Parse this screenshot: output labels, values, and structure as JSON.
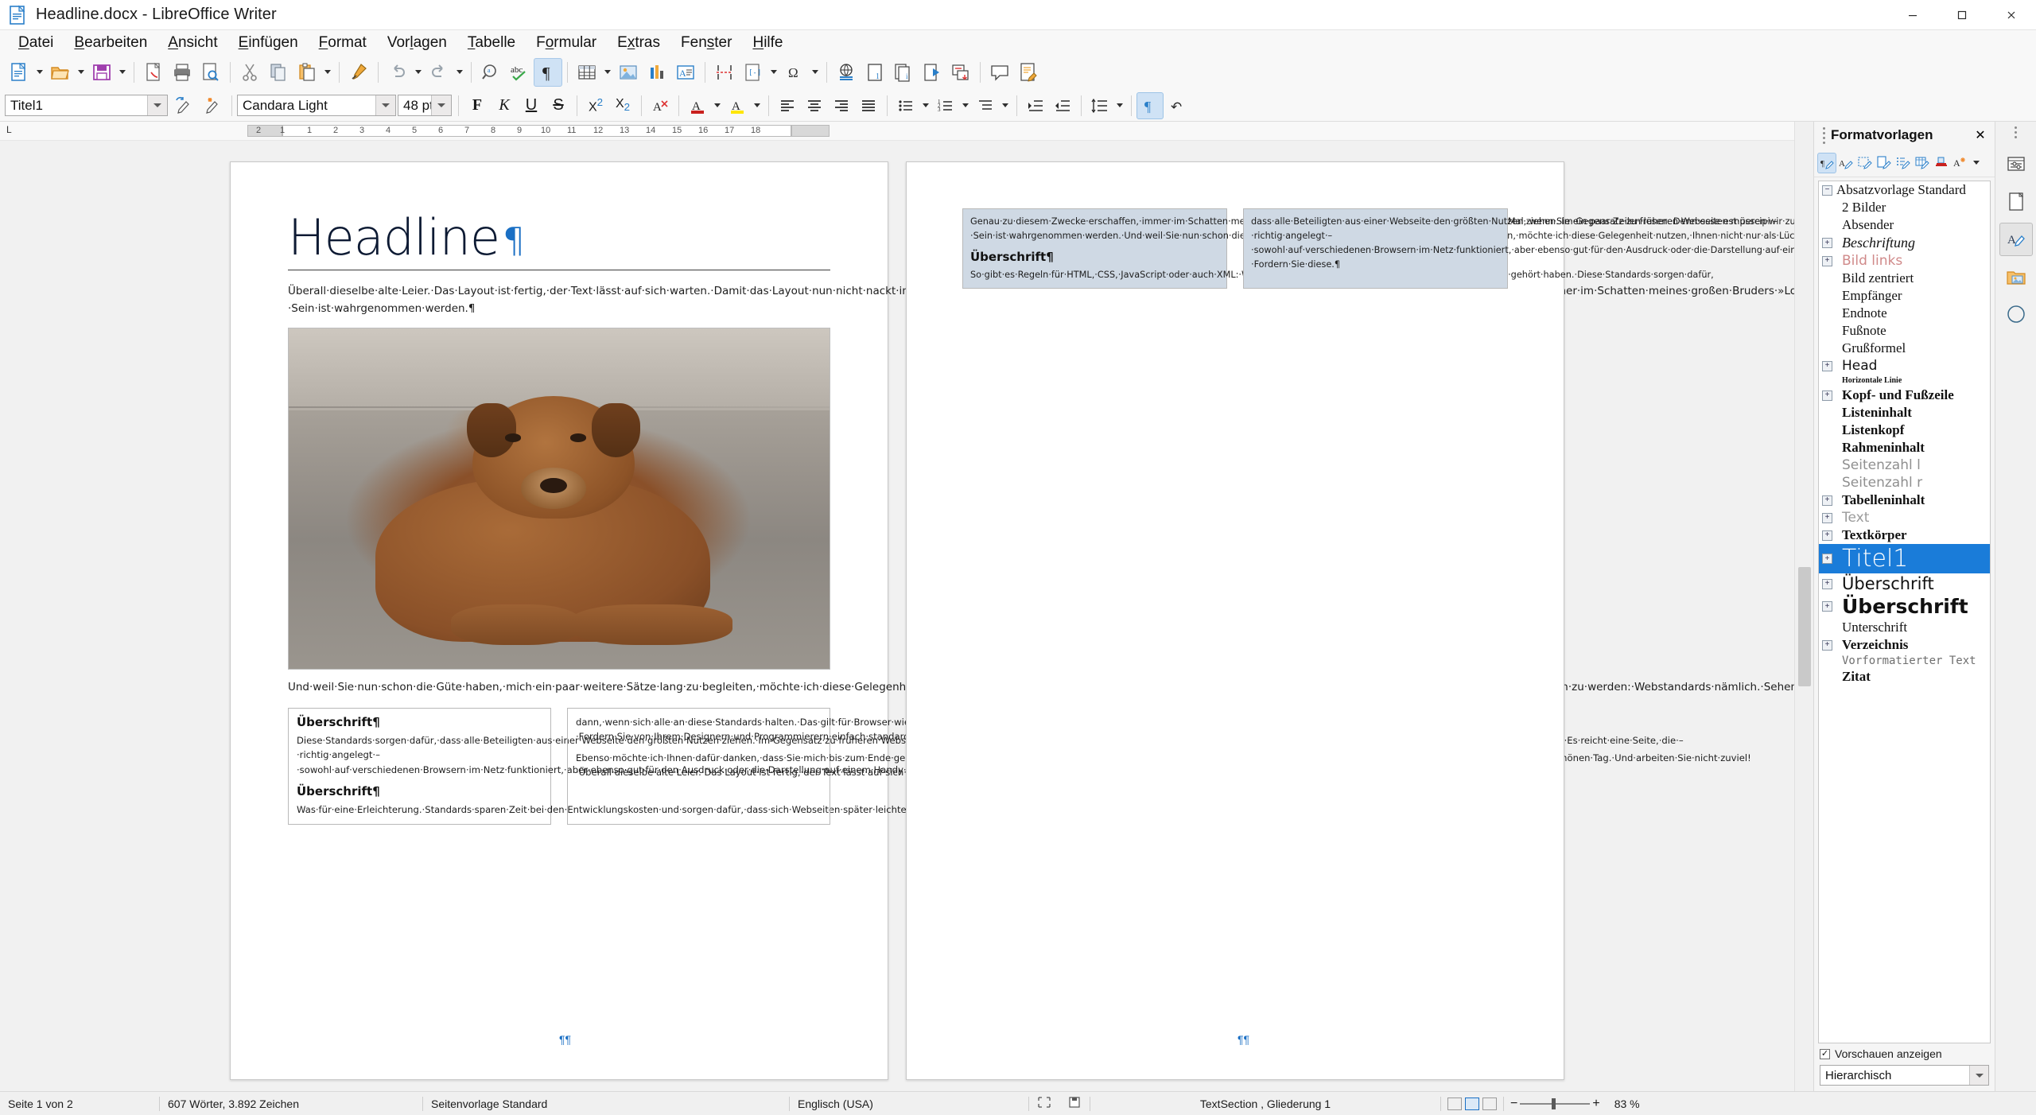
{
  "window": {
    "title": "Headline.docx - LibreOffice Writer",
    "minimize": "—",
    "maximize": "□",
    "close": "✕"
  },
  "menu": [
    {
      "label": "Datei",
      "accel": "D"
    },
    {
      "label": "Bearbeiten",
      "accel": "B"
    },
    {
      "label": "Ansicht",
      "accel": "A"
    },
    {
      "label": "Einfügen",
      "accel": "E"
    },
    {
      "label": "Format",
      "accel": "F"
    },
    {
      "label": "Vorlagen",
      "accel": "l"
    },
    {
      "label": "Tabelle",
      "accel": "T"
    },
    {
      "label": "Formular",
      "accel": "o"
    },
    {
      "label": "Extras",
      "accel": "x"
    },
    {
      "label": "Fenster",
      "accel": "s"
    },
    {
      "label": "Hilfe",
      "accel": "H"
    }
  ],
  "toolbar_main": [
    {
      "name": "new-document",
      "tooltip": "Neu"
    },
    {
      "name": "open-document",
      "tooltip": "Öffnen"
    },
    {
      "name": "save-document",
      "tooltip": "Speichern"
    },
    {
      "name": "export-pdf",
      "tooltip": "Direkt als PDF exportieren"
    },
    {
      "name": "print",
      "tooltip": "Drucken"
    },
    {
      "name": "print-preview",
      "tooltip": "Druckvorschau"
    },
    {
      "name": "cut",
      "tooltip": "Ausschneiden"
    },
    {
      "name": "copy",
      "tooltip": "Kopieren"
    },
    {
      "name": "paste",
      "tooltip": "Einfügen"
    },
    {
      "name": "clone-formatting",
      "tooltip": "Formatierung klonen"
    },
    {
      "name": "undo",
      "tooltip": "Rückgängig"
    },
    {
      "name": "redo",
      "tooltip": "Wiederherstellen"
    },
    {
      "name": "find-replace",
      "tooltip": "Suchen und Ersetzen"
    },
    {
      "name": "spelling",
      "tooltip": "Rechtschreibung"
    },
    {
      "name": "formatting-marks",
      "tooltip": "Formatierungszeichen",
      "active": true
    },
    {
      "name": "insert-table",
      "tooltip": "Tabelle einfügen"
    },
    {
      "name": "insert-image",
      "tooltip": "Bild einfügen"
    },
    {
      "name": "insert-chart",
      "tooltip": "Diagramm einfügen"
    },
    {
      "name": "insert-text-box",
      "tooltip": "Textfeld einfügen"
    },
    {
      "name": "page-break",
      "tooltip": "Seitenumbruch einfügen"
    },
    {
      "name": "insert-field",
      "tooltip": "Feldbefehl einfügen"
    },
    {
      "name": "insert-special-character",
      "tooltip": "Sonderzeichen einfügen"
    },
    {
      "name": "insert-hyperlink",
      "tooltip": "Hyperlink einfügen"
    },
    {
      "name": "insert-footnote",
      "tooltip": "Fußnote einfügen"
    },
    {
      "name": "insert-endnote",
      "tooltip": "Endnote einfügen"
    },
    {
      "name": "insert-bookmark",
      "tooltip": "Lesezeichen einfügen"
    },
    {
      "name": "insert-cross-reference",
      "tooltip": "Querverweis einfügen"
    },
    {
      "name": "insert-comment",
      "tooltip": "Kommentar einfügen"
    },
    {
      "name": "track-changes",
      "tooltip": "Änderungen aufzeichnen"
    }
  ],
  "formatting": {
    "paragraph_style": "Titel1",
    "font_name": "Candara Light",
    "font_size": "48 pt",
    "bold": "F",
    "italic": "K",
    "underline": "U",
    "strikethrough": "S",
    "superscript": "X²",
    "subscript": "X₂",
    "clear_formatting": "A",
    "font_color": "A",
    "highlight_color": "A",
    "align_left": "≡",
    "align_center": "≡",
    "align_right": "≡",
    "align_justify": "≡",
    "formatting_marks_label": "¶"
  },
  "ruler": {
    "ticks": [
      "2",
      "1",
      "1",
      "2",
      "3",
      "4",
      "5",
      "6",
      "7",
      "8",
      "9",
      "10",
      "11",
      "12",
      "13",
      "14",
      "15",
      "16",
      "17",
      "18"
    ],
    "left_marker": "L"
  },
  "document": {
    "page1": {
      "headline": "Headline",
      "pilcrow": "¶",
      "intro": "Überall·dieselbe·alte·Leier.·Das·Layout·ist·fertig,·der·Text·lässt·auf·sich·warten.·Damit·das·Layout·nun·nicht·nackt·im·Raume·steht·und·sich·klein·und·leer·vorkommt,·springe·ich·ein:·der·Blindtext.·Genau·zu·diesem·Zwecke·erschaffen,·immer·im·Schatten·meines·großen·Bruders·»Lorem·Ipsum«,·freue·ich·mich·jedes·Mal,·wenn·Sie·ein·paar·Zeilen·lesen.·Denn·esse·est·percipi·–·Sein·ist·wahrgenommen·werden.¶",
      "image_caption_para": "Und·weil·Sie·nun·schon·die·Güte·haben,·mich·ein·paar·weitere·Sätze·lang·zu·begleiten,·möchte·ich·diese·Gelegenheit·nutzen,·Ihnen·nicht·nur·als·Lückenfüller·zu·dienen,·sondern·auf·etwas·hinzuweisen.·Es·ebenso·verdient·wahrgenommen·zu·werden:·Webstandards·nämlich.·Sehen·Sie,·Webstandards·sind·das·Regelwerk,·auf·dem·Webseiten·aufbauen.·So·gibt·es·Regeln·für·HTML,·CSS,·JavaScript·oder·auch·XML:·Worte,·die·Sie·vielleicht·schon·einmal·von·Ihrem·Entwickler·gehört·haben.¶",
      "col_left": {
        "heading": "Überschrift¶",
        "body1": "Diese·Standards·sorgen·dafür,·dass·alle·Beteiligten·aus·einer·Webseite·den·größten·Nutzen·ziehen.·Im·Gegensatz·zu·früheren·Webseiten·müssen·wir·zum·Beispiel·nicht·mehr·zwei·verschiedene·Webseiten·für·den·Internet·Explorer·und·einen·anderen·Browser·programmieren.·Es·reicht·eine·Seite,·die·–·richtig·angelegt·–·sowohl·auf·verschiedenen·Browsern·im·Netz·funktioniert,·aber·ebenso·gut·für·den·Ausdruck·oder·die·Darstellung·auf·einem·Handy·geeignet·ist.·Wohlgemerkt:·Eine·Seite·für·alle·Formate.¶",
        "heading2": "Überschrift¶",
        "body2": "Was·für·eine·Erleichterung.·Standards·sparen·Zeit·bei·den·Entwicklungskosten·und·sorgen·dafür,·dass·sich·Webseiten·später·leichter·pflegen·lassen.·Natürlich·nur"
      },
      "col_right": {
        "body1": "dann,·wenn·sich·alle·an·diese·Standards·halten.·Das·gilt·für·Browser·wie·Firefox,·Opera,·Safari·und·den·Internet·Explorer·ebenso·wie·für·die·Darstellung·in·Handys.·Und·was·können·Sie·für·Standards·tun?·Fordern·Sie·von·Ihrem·Designern·und·Programmierern·einfach·standardkonforme·Webseiten.·Ihr·Budget·wird·es·Ihnen·auf·Dauer·danken.¶",
        "body2": "Ebenso·möchte·ich·Ihnen·dafür·danken,·dass·Sie·mich·bis·zum·Ende·gelesen·haben.·Meine·Mission·ist·erfüllt.·Ich·werde·hier·noch·die·Stellung·halten,·bis·der·geplante·Text·eintrifft.·Ich·wünsche·Ihnen·noch·einen·schönen·Tag.·Und·arbeiten·Sie·nicht·zuviel!·Überall·dieselbe·alte·Leier.·Das·Layout·ist·fertig,·der·Text·lässt·auf·sich·warten.·Damit·das·Layout·nun·nicht·nackt·im·Raume·steht·und·sich·klein·und·leer·vorkommt,·springe·ich·ein:·der·Blindtext.¶"
      },
      "end_mark": "¶¶"
    },
    "page2": {
      "col_left": {
        "body1": "Genau·zu·diesem·Zwecke·erschaffen,·immer·im·Schatten·meines·großen·Bruders·»Lorem·Ipsum«,·freue·ich·mich·jedes·Mal,·wenn·Sie·ein·paar·Zeilen·lesen.·Denn·esse·est·percipi·–·Sein·ist·wahrgenommen·werden.·Und·weil·Sie·nun·schon·die·Güte·haben,·mich·ein·paar·weitere·Sätze·lang·zu·begleiten,·möchte·ich·diese·Gelegenheit·nutzen,·Ihnen·nicht·nur·als·Lückenfüller·zu·dienen,·sondern·auf·etwas·hinzuweisen,·das·es·ebenso·verdient·wahrgenommen·zu·werden:·Webstandards·nämlich.·Sehen·Sie,·Webstandards·sind·das·Regelwerk,·auf·dem·Webseiten·aufbauen.¶",
        "heading": "Überschrift¶",
        "body2": "So·gibt·es·Regeln·für·HTML,·CSS,·JavaScript·oder·auch·XML:·Worte,·die·Sie·vielleicht·schon·einmal·von·Ihrem·Entwickler·gehört·haben.·Diese·Standards·sorgen·dafür,"
      },
      "col_right": {
        "body1": "dass·alle·Beteiligten·aus·einer·Webseite·den·größten·Nutzen·ziehen.·Im·Gegensatz·zu·früheren·Webseiten·müssen·wir·zum·Beispiel·nicht·mehr·zwei·verschiedene·Webseiten·für·den·Internet·Explorer·und·einen·anderen·Browser·programmieren.·Es·reicht·eine·Seite,·die·–·richtig·angelegt·–·sowohl·auf·verschiedenen·Browsern·im·Netz·funktioniert,·aber·ebenso·gut·für·den·Ausdruck·oder·die·Darstellung·auf·einem·Handy·geeignet·ist.·Wohlgemerkt:·Standards·sparen·Zeit·bei·den·Entwicklungskosten·und·sorgen·dafür,·dass·sich·Webseiten·später·leichter·pflegen·lassen.·Natürlich·nur·dann,·wenn·sich·alle·an·diese·Standards·halten.·Das·gilt·für·Browser·wie·Firefox,·Opera,·Safari·und·den·Internet·Explorer·ebenso·wie·für·die·Darstellung·in·Handys.·Und·was·können·Sie·für·Standards·tun?·Fordern·Sie·diese.¶"
      },
      "end_mark": "¶¶"
    }
  },
  "sidebar": {
    "title": "Formatvorlagen",
    "close": "✕",
    "toolbar": [
      {
        "name": "paragraph-styles",
        "selected": true
      },
      {
        "name": "character-styles",
        "selected": false
      },
      {
        "name": "frame-styles",
        "selected": false
      },
      {
        "name": "page-styles",
        "selected": false
      },
      {
        "name": "list-styles",
        "selected": false
      },
      {
        "name": "table-styles",
        "selected": false
      },
      {
        "name": "fill-format-mode",
        "selected": false
      },
      {
        "name": "new-style-from-selection",
        "selected": false
      }
    ],
    "styles": [
      {
        "label": "Absatzvorlage Standard",
        "expander": "minus",
        "indent": 0,
        "preview": "s-serif"
      },
      {
        "label": "2 Bilder",
        "expander": "none",
        "indent": 1,
        "preview": "s-serif"
      },
      {
        "label": "Absender",
        "expander": "none",
        "indent": 1,
        "preview": "s-serif"
      },
      {
        "label": "Beschriftung",
        "expander": "plus",
        "indent": 1,
        "preview": "s-serifI"
      },
      {
        "label": "Bild links",
        "expander": "plus",
        "indent": 1,
        "preview": "s-sansPnk"
      },
      {
        "label": "Bild zentriert",
        "expander": "none",
        "indent": 1,
        "preview": "s-serif"
      },
      {
        "label": "Empfänger",
        "expander": "none",
        "indent": 1,
        "preview": "s-serif"
      },
      {
        "label": "Endnote",
        "expander": "none",
        "indent": 1,
        "preview": "s-serif"
      },
      {
        "label": "Fußnote",
        "expander": "none",
        "indent": 1,
        "preview": "s-serif"
      },
      {
        "label": "Grußformel",
        "expander": "none",
        "indent": 1,
        "preview": "s-serif"
      },
      {
        "label": "Head",
        "expander": "plus",
        "indent": 1,
        "preview": "s-sans"
      },
      {
        "label": "Horizontale Linie",
        "expander": "none",
        "indent": 1,
        "preview": "s-tiny"
      },
      {
        "label": "Kopf- und Fußzeile",
        "expander": "plus",
        "indent": 1,
        "preview": "s-serifB"
      },
      {
        "label": "Listeninhalt",
        "expander": "none",
        "indent": 1,
        "preview": "s-serifB"
      },
      {
        "label": "Listenkopf",
        "expander": "none",
        "indent": 1,
        "preview": "s-serifB"
      },
      {
        "label": "Rahmeninhalt",
        "expander": "none",
        "indent": 1,
        "preview": "s-serifB"
      },
      {
        "label": "Seitenzahl l",
        "expander": "none",
        "indent": 1,
        "preview": "s-sansLt"
      },
      {
        "label": "Seitenzahl r",
        "expander": "none",
        "indent": 1,
        "preview": "s-sansLt"
      },
      {
        "label": "Tabelleninhalt",
        "expander": "plus",
        "indent": 1,
        "preview": "s-serifB"
      },
      {
        "label": "Text",
        "expander": "plus",
        "indent": 1,
        "preview": "s-sansGry"
      },
      {
        "label": "Textkörper",
        "expander": "plus",
        "indent": 1,
        "preview": "s-serifB"
      },
      {
        "label": "Titel1",
        "expander": "plus",
        "indent": 1,
        "preview": "s-big",
        "selected": true
      },
      {
        "label": "Überschrift",
        "expander": "plus",
        "indent": 1,
        "preview": "s-ub1"
      },
      {
        "label": "Überschrift",
        "expander": "plus",
        "indent": 1,
        "preview": "s-ub2"
      },
      {
        "label": "Unterschrift",
        "expander": "none",
        "indent": 1,
        "preview": "s-serif"
      },
      {
        "label": "Verzeichnis",
        "expander": "plus",
        "indent": 1,
        "preview": "s-serifB"
      },
      {
        "label": "Vorformatierter Text",
        "expander": "none",
        "indent": 1,
        "preview": "s-mono"
      },
      {
        "label": "Zitat",
        "expander": "none",
        "indent": 1,
        "preview": "s-serifB"
      }
    ],
    "show_previews": "Vorschauen anzeigen",
    "show_previews_checked": true,
    "filter": "Hierarchisch"
  },
  "rail": [
    {
      "name": "sidebar-settings",
      "selected": false
    },
    {
      "name": "properties-deck",
      "selected": false
    },
    {
      "name": "page-deck",
      "selected": false
    },
    {
      "name": "styles-deck",
      "selected": true
    },
    {
      "name": "gallery-deck",
      "selected": false
    },
    {
      "name": "navigator-deck",
      "selected": false
    }
  ],
  "statusbar": {
    "page": "Seite 1 von 2",
    "words": "607 Wörter, 3.892 Zeichen",
    "page_style": "Seitenvorlage Standard",
    "language": "Englisch (USA)",
    "selection_mode": "",
    "save_state": "",
    "section": "TextSection , Gliederung 1",
    "zoom": "83 %"
  },
  "colors": {
    "accent": "#1a7cd9",
    "pilcrow": "#1a6fc4",
    "selection": "#cfd9e4",
    "toolbar_active": "#cfe2f5"
  }
}
